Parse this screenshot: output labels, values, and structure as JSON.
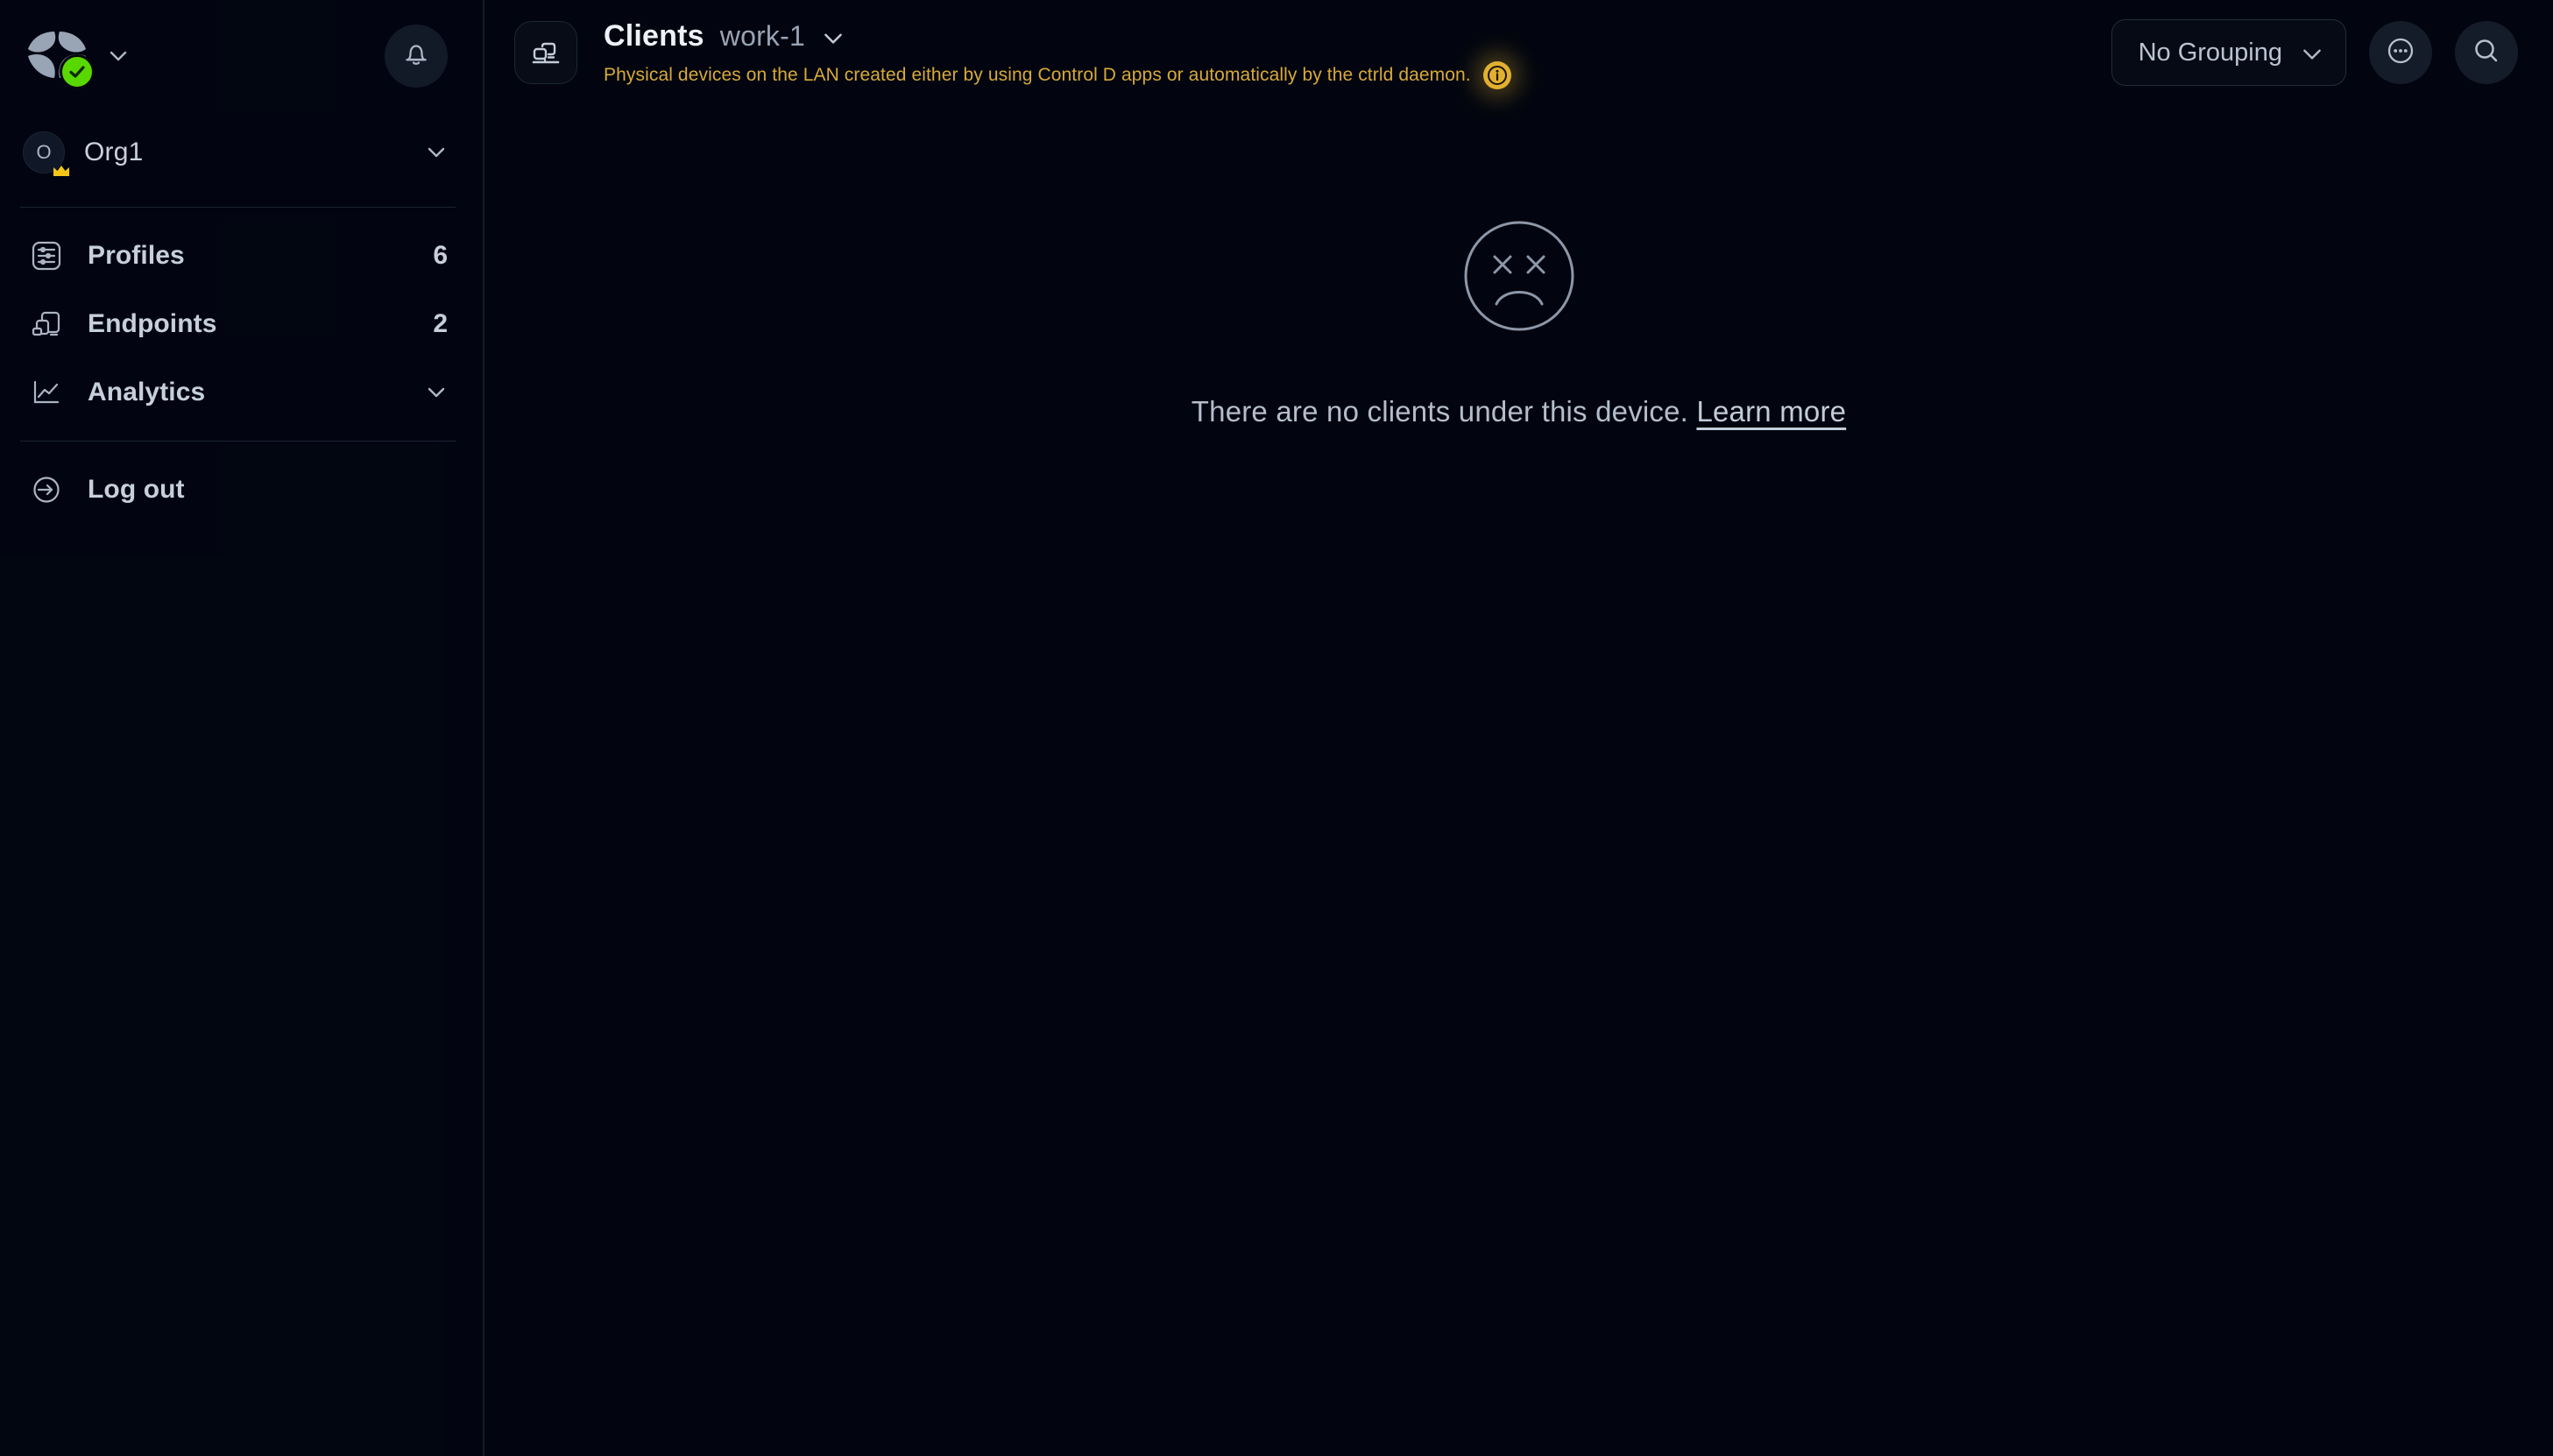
{
  "sidebar": {
    "logo": {
      "icon": "controld-logo-icon",
      "status_icon": "green-check-badge-icon"
    },
    "logo_chevron_icon": "chevron-down-icon",
    "notifications_icon": "bell-icon",
    "org": {
      "avatar_initial": "O",
      "name": "Org1",
      "badge_icon": "crown-icon",
      "chevron_icon": "chevron-down-icon"
    },
    "items": [
      {
        "label": "Profiles",
        "count": "6",
        "icon": "sliders-icon"
      },
      {
        "label": "Endpoints",
        "count": "2",
        "icon": "devices-icon"
      },
      {
        "label": "Analytics",
        "count": "",
        "icon": "line-chart-icon",
        "chevron_icon": "chevron-down-icon"
      }
    ],
    "logout": {
      "label": "Log out",
      "icon": "logout-arrow-icon"
    }
  },
  "header": {
    "page_icon": "clients-network-icon",
    "title": "Clients",
    "device": "work-1",
    "device_chevron_icon": "chevron-down-icon",
    "subtitle": "Physical devices on the LAN created either by using Control D apps or automatically by the ctrld daemon.",
    "info_icon": "info-circle-icon",
    "grouping": {
      "value": "No Grouping",
      "chevron_icon": "chevron-down-icon",
      "options": [
        "No Grouping"
      ]
    },
    "more_icon": "more-options-circle-icon",
    "search_icon": "search-icon"
  },
  "empty_state": {
    "icon": "sad-face-x-eyes-icon",
    "message": "There are no clients under this device.",
    "link_label": "Learn more"
  },
  "colors": {
    "background": "#02050f",
    "sidebar_divider": "#1b2332",
    "accent_warning": "#d8a93a",
    "accent_badge": "#e2b030",
    "status_green": "#59d800",
    "crown_gold": "#f5c518",
    "text_primary": "#eef2f8",
    "text_secondary": "#98a3b4"
  }
}
